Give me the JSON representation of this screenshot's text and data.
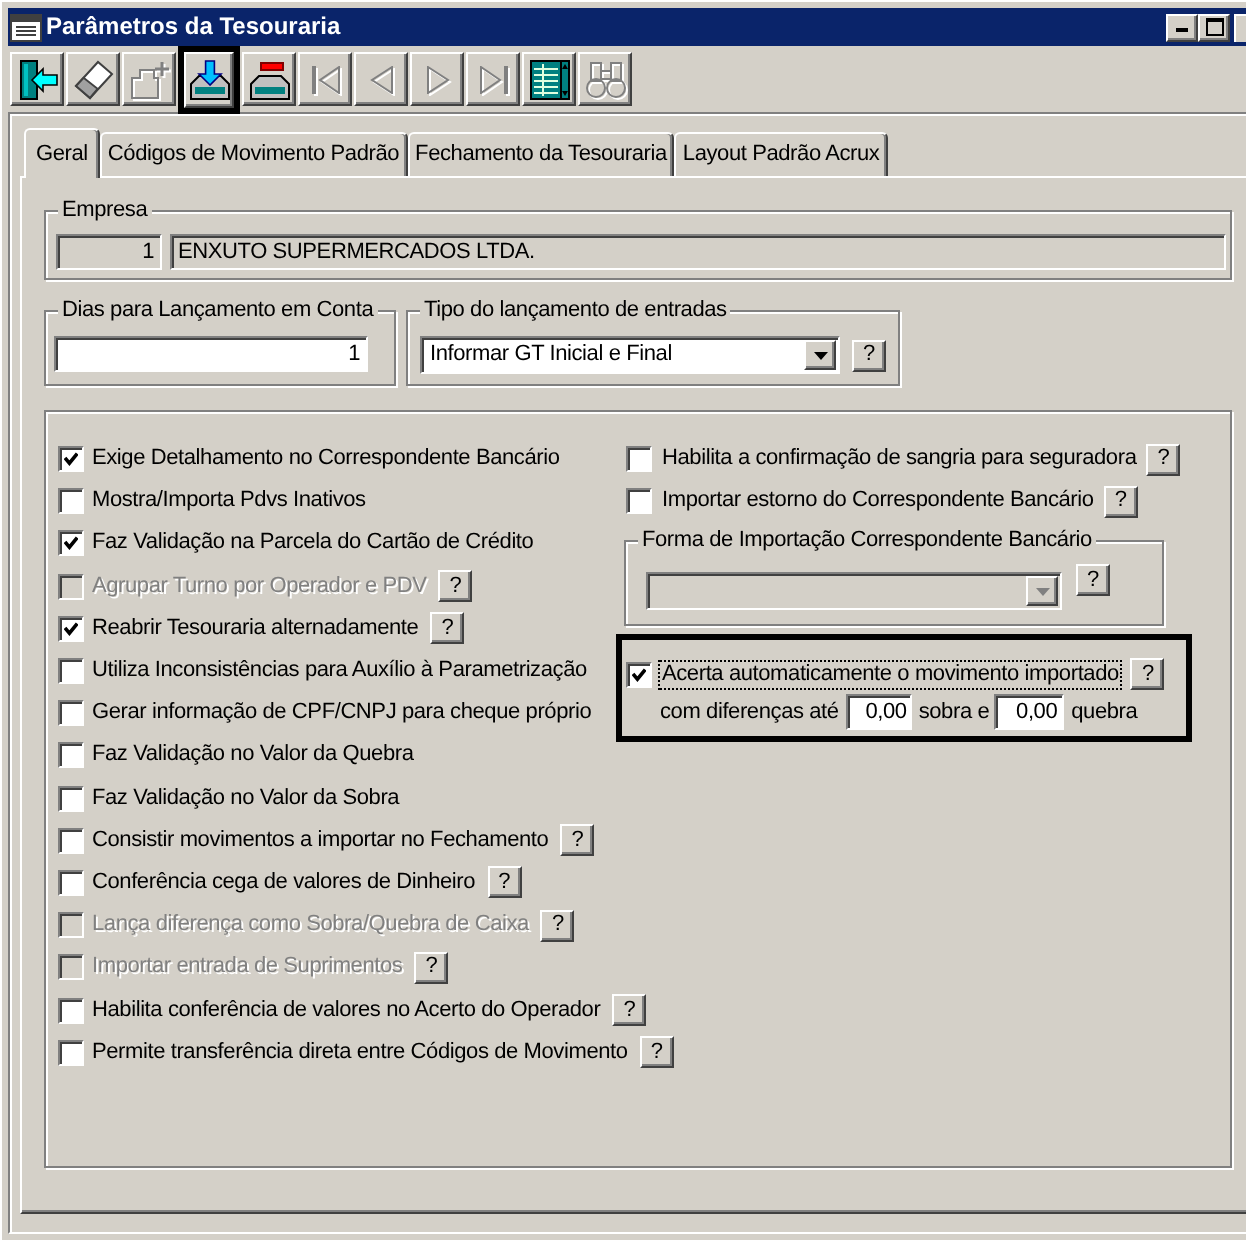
{
  "window": {
    "title": "Parâmetros da Tesouraria"
  },
  "toolbar": [
    {
      "kind": "exit",
      "disabled": false,
      "highlighted": false
    },
    {
      "kind": "eraser",
      "disabled": false,
      "highlighted": false
    },
    {
      "kind": "add",
      "disabled": true,
      "highlighted": false
    },
    {
      "kind": "save",
      "disabled": false,
      "highlighted": true
    },
    {
      "kind": "remove",
      "disabled": false,
      "highlighted": false
    },
    {
      "kind": "first",
      "disabled": true,
      "highlighted": false
    },
    {
      "kind": "previous",
      "disabled": true,
      "highlighted": false
    },
    {
      "kind": "next",
      "disabled": true,
      "highlighted": false
    },
    {
      "kind": "last",
      "disabled": true,
      "highlighted": false
    },
    {
      "kind": "grid",
      "disabled": false,
      "highlighted": false
    },
    {
      "kind": "search",
      "disabled": true,
      "highlighted": false
    }
  ],
  "tabs": [
    {
      "label": "Geral",
      "selected": true
    },
    {
      "label": "Códigos de Movimento Padrão",
      "selected": false
    },
    {
      "label": "Fechamento da Tesouraria",
      "selected": false
    },
    {
      "label": "Layout Padrão Acrux",
      "selected": false
    }
  ],
  "empresa": {
    "legend": "Empresa",
    "code": "1",
    "name": "ENXUTO SUPERMERCADOS LTDA."
  },
  "dias": {
    "legend": "Dias para Lançamento em Conta",
    "value": "1"
  },
  "tipo": {
    "legend": "Tipo do lançamento de entradas",
    "value": "Informar GT Inicial e Final",
    "help": "?"
  },
  "options_left": [
    {
      "label": "Exige Detalhamento no Correspondente Bancário",
      "checked": true,
      "disabled": false
    },
    {
      "label": "Mostra/Importa Pdvs Inativos",
      "checked": false,
      "disabled": false
    },
    {
      "label": "Faz Validação na Parcela do Cartão de Crédito",
      "checked": true,
      "disabled": false
    },
    {
      "label": "Agrupar Turno por Operador e PDV",
      "checked": false,
      "disabled": true,
      "help": "?"
    },
    {
      "label": "Reabrir Tesouraria alternadamente",
      "checked": true,
      "disabled": false,
      "help": "?"
    },
    {
      "label": "Utiliza Inconsistências para Auxílio à Parametrização",
      "checked": false,
      "disabled": false
    },
    {
      "label": "Gerar informação de CPF/CNPJ para cheque próprio",
      "checked": false,
      "disabled": false
    },
    {
      "label": "Faz Validação no Valor da Quebra",
      "checked": false,
      "disabled": false
    },
    {
      "label": "Faz Validação no Valor da Sobra",
      "checked": false,
      "disabled": false
    },
    {
      "label": "Consistir movimentos a importar no Fechamento",
      "checked": false,
      "disabled": false,
      "help": "?"
    },
    {
      "label": "Conferência cega de valores de Dinheiro",
      "checked": false,
      "disabled": false,
      "help": "?"
    },
    {
      "label": "Lança diferença como Sobra/Quebra de Caixa",
      "checked": false,
      "disabled": true,
      "help": "?"
    },
    {
      "label": "Importar entrada de Suprimentos",
      "checked": false,
      "disabled": true,
      "help": "?"
    },
    {
      "label": "Habilita conferência de valores no Acerto do Operador",
      "checked": false,
      "disabled": false,
      "help": "?"
    },
    {
      "label": "Permite transferência direta entre Códigos de Movimento",
      "checked": false,
      "disabled": false,
      "help": "?"
    }
  ],
  "options_right": [
    {
      "label": "Habilita a confirmação de sangria para seguradora",
      "checked": false,
      "disabled": false,
      "help": "?"
    },
    {
      "label": "Importar estorno do Correspondente Bancário",
      "checked": false,
      "disabled": false,
      "help": "?"
    }
  ],
  "forma": {
    "legend": "Forma de Importação Correspondente Bancário",
    "disabled": true,
    "help": "?"
  },
  "acerta": {
    "highlighted": true,
    "label": "Acerta automaticamente o movimento importado",
    "checked": true,
    "focused": true,
    "help": "?",
    "prefix": "com diferenças até",
    "sobra": "0,00",
    "middle": "sobra e",
    "quebra": "0,00",
    "suffix": "quebra"
  }
}
